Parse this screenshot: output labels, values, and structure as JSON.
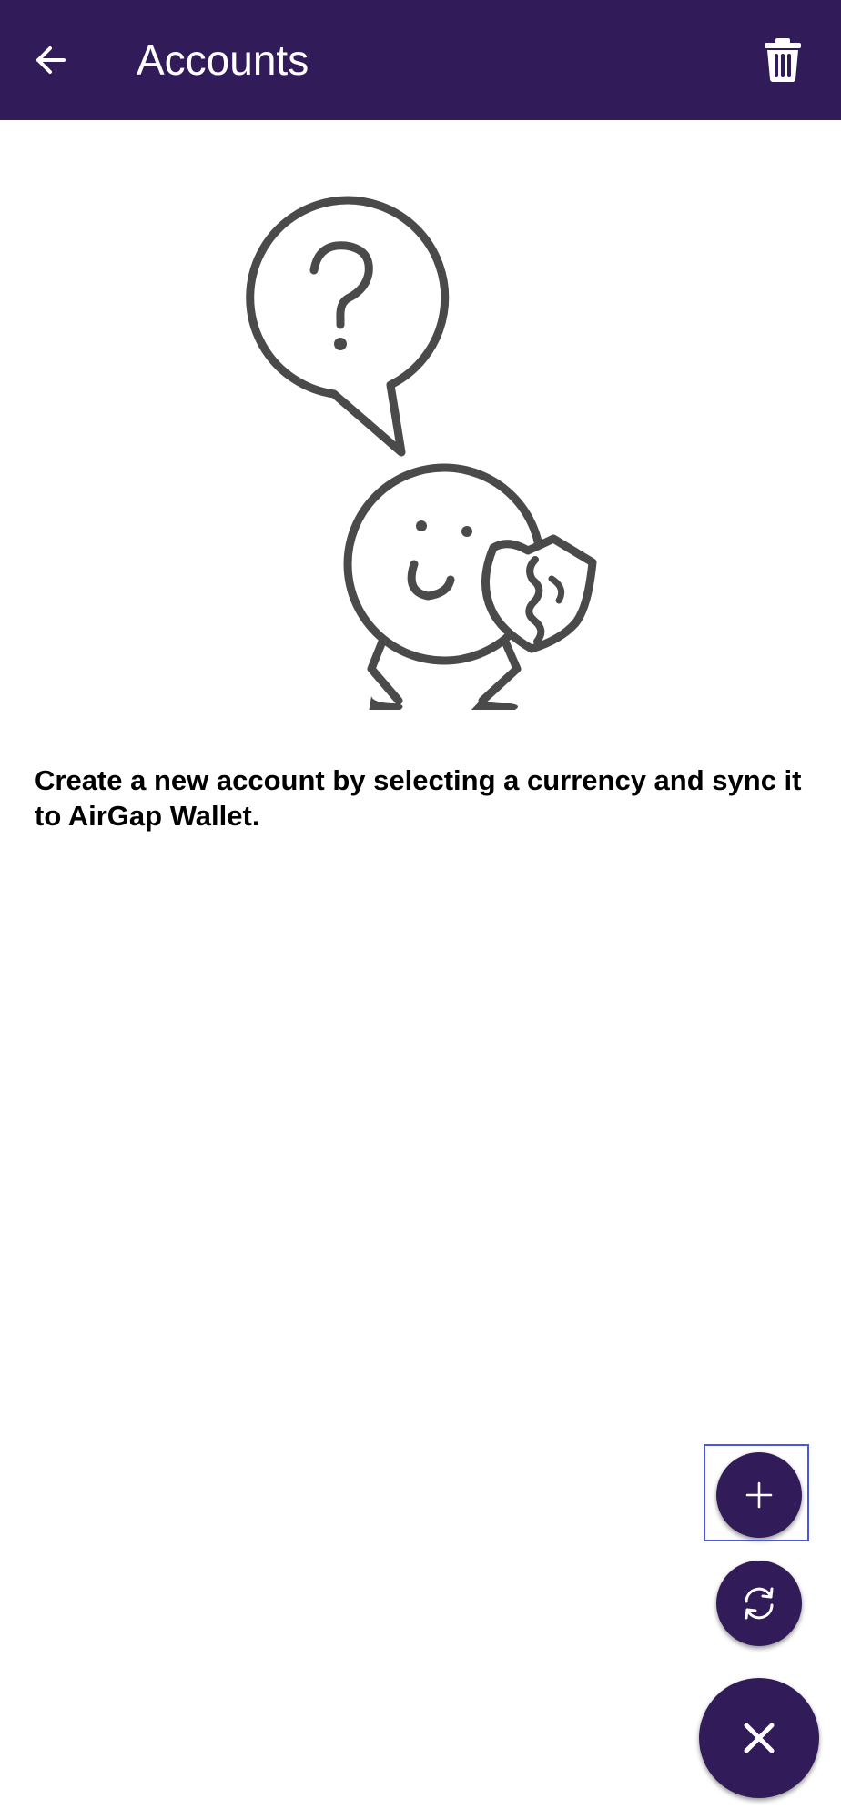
{
  "header": {
    "title": "Accounts",
    "back_icon": "arrow-back-icon",
    "delete_icon": "trash-icon"
  },
  "empty_state": {
    "illustration": "thinking-character-with-question-bubble",
    "message": "Create a new account by selecting a currency and sync it to AirGap Wallet."
  },
  "fab_menu": {
    "add_icon": "plus-icon",
    "sync_icon": "sync-icon",
    "close_icon": "close-icon"
  },
  "colors": {
    "primary": "#311b58",
    "on_primary": "#ffffff",
    "illustration_stroke": "#4a4a4a",
    "highlight": "#4a57d6"
  }
}
